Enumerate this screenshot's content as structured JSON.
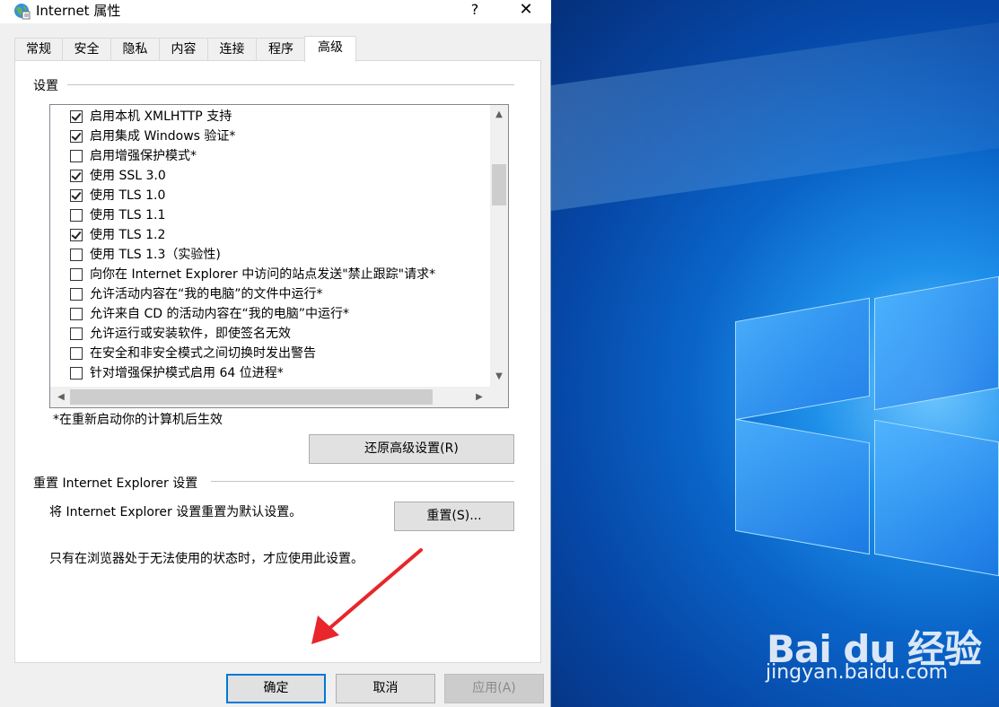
{
  "window": {
    "title": "Internet 属性",
    "help": "?",
    "close": "✕"
  },
  "tabs": [
    {
      "label": "常规"
    },
    {
      "label": "安全"
    },
    {
      "label": "隐私"
    },
    {
      "label": "内容"
    },
    {
      "label": "连接"
    },
    {
      "label": "程序"
    },
    {
      "label": "高级",
      "active": true
    }
  ],
  "settings": {
    "group_label": "设置",
    "items": [
      {
        "label": "启用本机 XMLHTTP 支持",
        "checked": true
      },
      {
        "label": "启用集成 Windows 验证*",
        "checked": true
      },
      {
        "label": "启用增强保护模式*",
        "checked": false
      },
      {
        "label": "使用 SSL 3.0",
        "checked": true
      },
      {
        "label": "使用 TLS 1.0",
        "checked": true
      },
      {
        "label": "使用 TLS 1.1",
        "checked": false
      },
      {
        "label": "使用 TLS 1.2",
        "checked": true
      },
      {
        "label": "使用 TLS 1.3（实验性)",
        "checked": false
      },
      {
        "label": "向你在 Internet Explorer 中访问的站点发送\"禁止跟踪\"请求*",
        "checked": false
      },
      {
        "label": "允许活动内容在“我的电脑”的文件中运行*",
        "checked": false
      },
      {
        "label": "允许来自 CD 的活动内容在“我的电脑”中运行*",
        "checked": false
      },
      {
        "label": "允许运行或安装软件，即使签名无效",
        "checked": false
      },
      {
        "label": "在安全和非安全模式之间切换时发出警告",
        "checked": false
      },
      {
        "label": "针对增强保护模式启用 64 位进程*",
        "checked": false
      }
    ],
    "restart_note": "*在重新启动你的计算机后生效",
    "restore_button": "还原高级设置(R)"
  },
  "reset": {
    "group_label": "重置 Internet Explorer 设置",
    "description": "将 Internet Explorer 设置重置为默认设置。",
    "reset_button": "重置(S)...",
    "warning": "只有在浏览器处于无法使用的状态时，才应使用此设置。"
  },
  "footer": {
    "ok": "确定",
    "cancel": "取消",
    "apply": "应用(A)"
  },
  "watermark": {
    "logo": "Bai du 经验",
    "url": "jingyan.baidu.com"
  },
  "colors": {
    "accent": "#0078d7",
    "desktop": "#0a64c8",
    "arrow": "#e8262b"
  }
}
